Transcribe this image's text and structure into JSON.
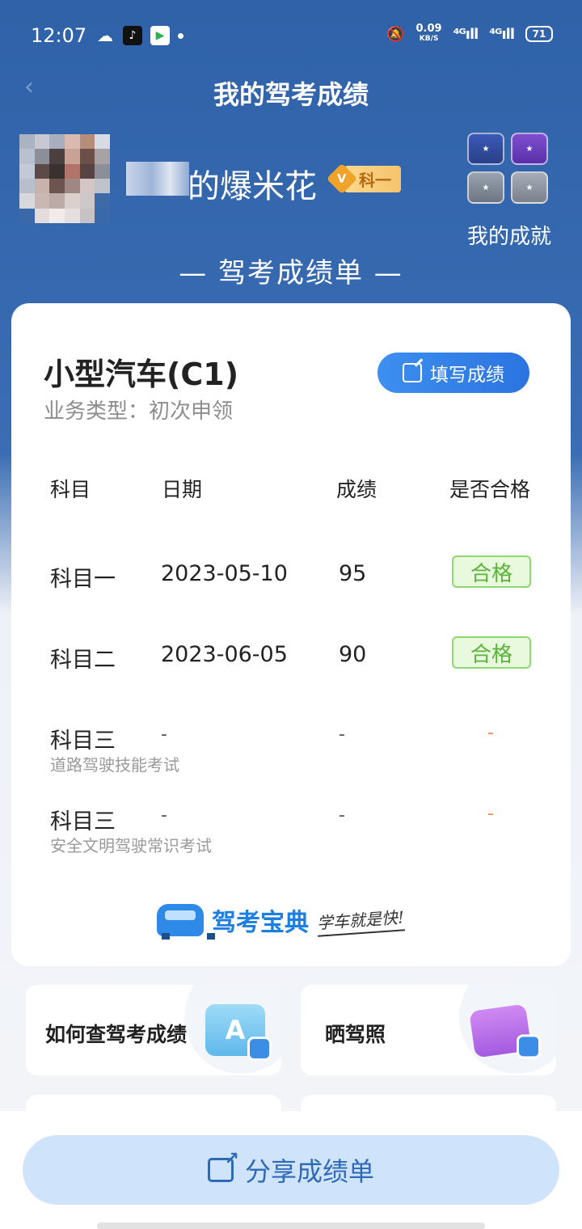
{
  "status_bar": {
    "time": "12:07",
    "net_speed": "0.09",
    "net_unit": "KB/S",
    "sig1": "⁴ᴳıll",
    "sig2": "⁴ᴳıll",
    "battery": "71",
    "icons": [
      "wechat-icon",
      "tiktok-icon",
      "video-app-icon",
      "notification-dot"
    ]
  },
  "header": {
    "title": "我的驾考成绩",
    "back_icon": "chevron-left-icon"
  },
  "profile": {
    "username": "的爆米花",
    "level_badge_letter": "V",
    "level_badge_text": "科一",
    "achievements_label": "我的成就"
  },
  "report": {
    "title": "— 驾考成绩单 —",
    "vehicle_type": "小型汽车(C1)",
    "business_type": "业务类型：初次申领",
    "fill_button": "填写成绩",
    "table": {
      "headers": [
        "科目",
        "日期",
        "成绩",
        "是否合格"
      ],
      "rows": [
        {
          "subject": "科目一",
          "sub": "",
          "date": "2023-05-10",
          "score": "95",
          "pass": "合格"
        },
        {
          "subject": "科目二",
          "sub": "",
          "date": "2023-06-05",
          "score": "90",
          "pass": "合格"
        },
        {
          "subject": "科目三",
          "sub": "道路驾驶技能考试",
          "date": "-",
          "score": "-",
          "pass": "-"
        },
        {
          "subject": "科目三",
          "sub": "安全文明驾驶常识考试",
          "date": "-",
          "score": "-",
          "pass": "-"
        }
      ]
    },
    "brand": {
      "name": "驾考宝典",
      "slogan": "学车就是快!"
    }
  },
  "tiles": {
    "how_to_check": "如何查驾考成绩",
    "show_license": "晒驾照",
    "tile1_icon_letter": "A"
  },
  "share_button": "分享成绩单",
  "colors": {
    "header_blue": "#2f62a8",
    "primary_button": "#2b74e0",
    "pass_green": "#5ab33a",
    "pass_bg": "#e8f9dd",
    "share_bg": "#cfe3fb"
  }
}
